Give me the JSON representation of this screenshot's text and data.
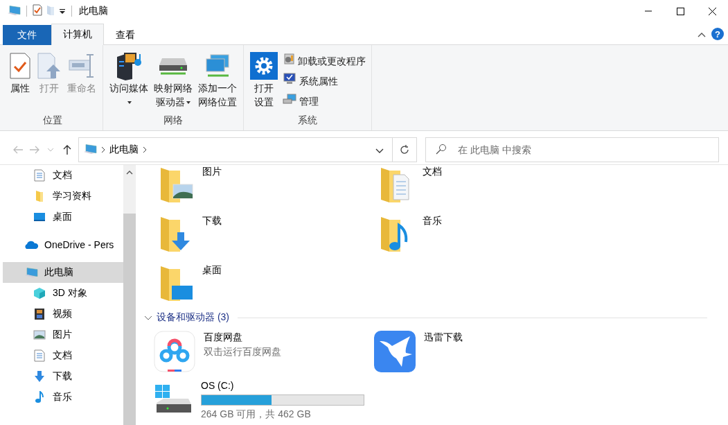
{
  "window": {
    "title": "此电脑"
  },
  "ribbon_tabs": [
    {
      "label": "文件",
      "kind": "file",
      "selected": false
    },
    {
      "label": "计算机",
      "kind": "tab",
      "selected": true
    },
    {
      "label": "查看",
      "kind": "tab",
      "selected": false
    }
  ],
  "help": {
    "glyph": "?"
  },
  "ribbon_groups": [
    {
      "label": "位置",
      "buttons": [
        {
          "lines": [
            "属性"
          ],
          "kind": "properties",
          "disabled": false,
          "dropdown": false
        },
        {
          "lines": [
            "打开"
          ],
          "kind": "open",
          "disabled": true,
          "dropdown": false
        },
        {
          "lines": [
            "重命名"
          ],
          "kind": "rename",
          "disabled": true,
          "dropdown": false
        }
      ]
    },
    {
      "label": "网络",
      "buttons": [
        {
          "lines": [
            "访问媒体"
          ],
          "kind": "media",
          "disabled": false,
          "dropdown": true
        },
        {
          "lines": [
            "映射网络",
            "驱动器"
          ],
          "kind": "netdrive",
          "disabled": false,
          "dropdown": true
        },
        {
          "lines": [
            "添加一个",
            "网络位置"
          ],
          "kind": "netlocation",
          "disabled": false,
          "dropdown": false
        }
      ]
    },
    {
      "label": "系统",
      "buttons": [
        {
          "lines": [
            "打开",
            "设置"
          ],
          "kind": "settings",
          "disabled": false,
          "dropdown": false
        }
      ],
      "small_buttons": [
        {
          "label": "卸载或更改程序",
          "kind": "uninstall"
        },
        {
          "label": "系统属性",
          "kind": "sysprops"
        },
        {
          "label": "管理",
          "kind": "manage"
        }
      ]
    }
  ],
  "address_bar": {
    "back_disabled": true,
    "forward_disabled": true,
    "path": [
      "此电脑"
    ]
  },
  "search": {
    "placeholder": "在 此电脑 中搜索"
  },
  "sidebar": {
    "items": [
      {
        "label": "文档",
        "kind": "documents",
        "indent": true,
        "selected": false
      },
      {
        "label": "学习资料",
        "kind": "folder",
        "indent": true,
        "selected": false
      },
      {
        "label": "桌面",
        "kind": "desktop",
        "indent": true,
        "selected": false
      },
      {
        "label": "OneDrive - Pers",
        "kind": "onedrive",
        "indent": false,
        "selected": false
      },
      {
        "label": "此电脑",
        "kind": "pc",
        "indent": false,
        "selected": true
      },
      {
        "label": "3D 对象",
        "kind": "cube",
        "indent": true,
        "selected": false
      },
      {
        "label": "视频",
        "kind": "video",
        "indent": true,
        "selected": false
      },
      {
        "label": "图片",
        "kind": "pictures",
        "indent": true,
        "selected": false
      },
      {
        "label": "文档",
        "kind": "documents",
        "indent": true,
        "selected": false
      },
      {
        "label": "下载",
        "kind": "download",
        "indent": true,
        "selected": false
      },
      {
        "label": "音乐",
        "kind": "music",
        "indent": true,
        "selected": false
      }
    ]
  },
  "folders": [
    {
      "name": "图片",
      "kind": "pictures"
    },
    {
      "name": "文档",
      "kind": "documents"
    },
    {
      "name": "下载",
      "kind": "download"
    },
    {
      "name": "音乐",
      "kind": "music"
    },
    {
      "name": "桌面",
      "kind": "desktop"
    }
  ],
  "devices_section": {
    "title": "设备和驱动器 (3)",
    "expanded": true
  },
  "devices": [
    {
      "kind": "baidu",
      "name": "百度网盘",
      "subtitle": "双击运行百度网盘"
    },
    {
      "kind": "xunlei",
      "name": "迅雷下载"
    },
    {
      "kind": "drive",
      "name": "OS (C:)",
      "level": 0.43,
      "reading": "264 GB 可用，共 462 GB"
    }
  ]
}
